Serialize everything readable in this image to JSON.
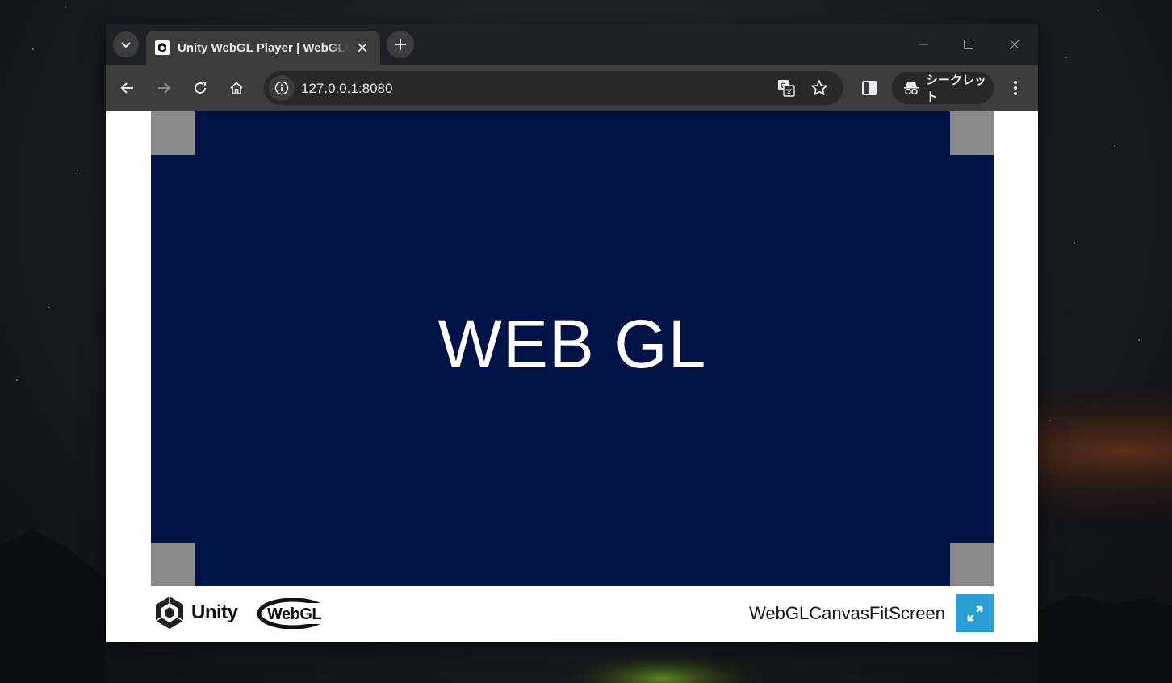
{
  "browser": {
    "tab_title": "Unity WebGL Player | WebGLCanvasFitScreen",
    "url": "127.0.0.1:8080",
    "incognito_label": "シークレット"
  },
  "page": {
    "canvas_text": "WEB GL",
    "footer": {
      "unity_logo_text": "Unity",
      "webgl_logo_text": "WebGL",
      "game_title": "WebGLCanvasFitScreen"
    }
  },
  "colors": {
    "canvas_bg": "#001346",
    "fullscreen_button": "#2a9fd6",
    "corner_markers": "#8a8a8a",
    "browser_frame": "#202124"
  },
  "icons": [
    "tab-search-icon",
    "unity-favicon-icon",
    "close-icon",
    "plus-icon",
    "minimize-icon",
    "maximize-icon",
    "back-icon",
    "forward-icon",
    "reload-icon",
    "home-icon",
    "info-icon",
    "translate-icon",
    "star-icon",
    "side-panel-icon",
    "incognito-icon",
    "kebab-menu-icon",
    "fullscreen-icon"
  ]
}
